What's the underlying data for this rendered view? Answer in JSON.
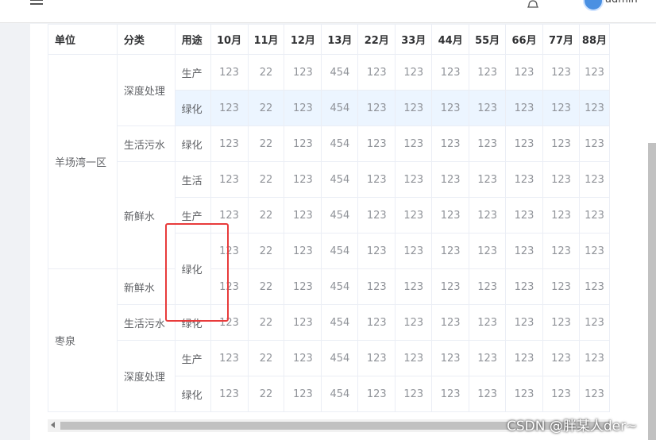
{
  "header": {
    "user": "admin"
  },
  "table": {
    "headers": [
      "单位",
      "分类",
      "用途",
      "10月",
      "11月",
      "12月",
      "13月",
      "22月",
      "33月",
      "44月",
      "55月",
      "66月",
      "77月",
      "88月"
    ],
    "groups": [
      {
        "unit": "羊场湾一区",
        "categories": [
          {
            "name": "深度处理",
            "uses": [
              {
                "name": "生产",
                "values": [
                  "123",
                  "22",
                  "123",
                  "454",
                  "123",
                  "123",
                  "123",
                  "123",
                  "123",
                  "123",
                  "123"
                ]
              },
              {
                "name": "绿化",
                "values": [
                  "123",
                  "22",
                  "123",
                  "454",
                  "123",
                  "123",
                  "123",
                  "123",
                  "123",
                  "123",
                  "123"
                ]
              }
            ]
          },
          {
            "name": "生活污水",
            "uses": [
              {
                "name": "绿化",
                "values": [
                  "123",
                  "22",
                  "123",
                  "454",
                  "123",
                  "123",
                  "123",
                  "123",
                  "123",
                  "123",
                  "123"
                ]
              }
            ]
          },
          {
            "name": "新鲜水",
            "uses": [
              {
                "name": "生活",
                "values": [
                  "123",
                  "22",
                  "123",
                  "454",
                  "123",
                  "123",
                  "123",
                  "123",
                  "123",
                  "123",
                  "123"
                ]
              },
              {
                "name": "生产",
                "values": [
                  "123",
                  "22",
                  "123",
                  "454",
                  "123",
                  "123",
                  "123",
                  "123",
                  "123",
                  "123",
                  "123"
                ]
              },
              {
                "name": "绿化",
                "values": [
                  "123",
                  "22",
                  "123",
                  "454",
                  "123",
                  "123",
                  "123",
                  "123",
                  "123",
                  "123",
                  "123"
                ]
              }
            ]
          }
        ]
      },
      {
        "unit": "枣泉",
        "categories": [
          {
            "name": "新鲜水",
            "uses": [
              {
                "name": "",
                "values": [
                  "123",
                  "22",
                  "123",
                  "454",
                  "123",
                  "123",
                  "123",
                  "123",
                  "123",
                  "123",
                  "123"
                ]
              }
            ]
          },
          {
            "name": "生活污水",
            "uses": [
              {
                "name": "绿化",
                "values": [
                  "123",
                  "22",
                  "123",
                  "454",
                  "123",
                  "123",
                  "123",
                  "123",
                  "123",
                  "123",
                  "123"
                ]
              }
            ]
          },
          {
            "name": "深度处理",
            "uses": [
              {
                "name": "生产",
                "values": [
                  "123",
                  "22",
                  "123",
                  "454",
                  "123",
                  "123",
                  "123",
                  "123",
                  "123",
                  "123",
                  "123"
                ]
              },
              {
                "name": "绿化",
                "values": [
                  "123",
                  "22",
                  "123",
                  "454",
                  "123",
                  "123",
                  "123",
                  "123",
                  "123",
                  "123",
                  "123"
                ]
              }
            ]
          }
        ]
      }
    ]
  },
  "watermark": "CSDN @胖某人der~",
  "colors": {
    "highlight": "#ecf5ff",
    "annotation": "#e83b3b",
    "border": "#ebeef5"
  }
}
